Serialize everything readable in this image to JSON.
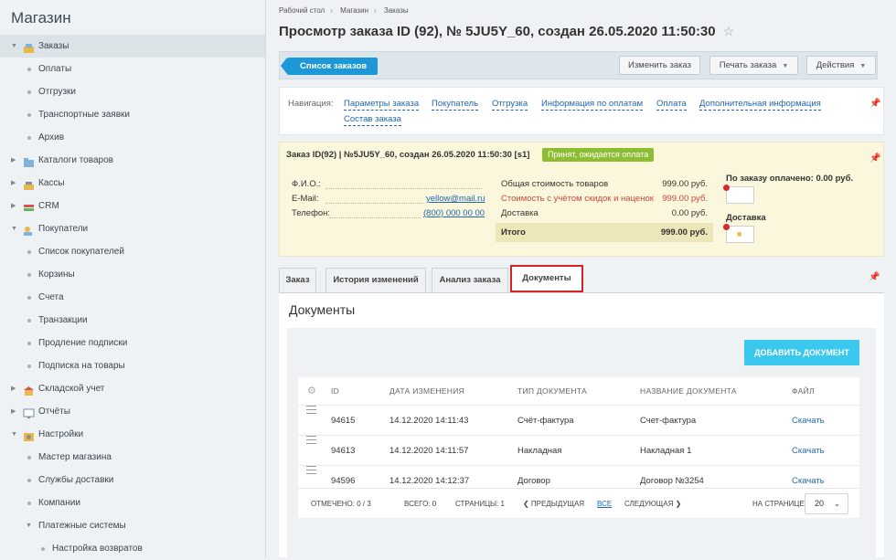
{
  "sidebar": {
    "title": "Магазин",
    "items": [
      {
        "label": "Заказы"
      },
      {
        "label": "Оплаты"
      },
      {
        "label": "Отгрузки"
      },
      {
        "label": "Транспортные заявки"
      },
      {
        "label": "Архив"
      },
      {
        "label": "Каталоги товаров"
      },
      {
        "label": "Кассы"
      },
      {
        "label": "CRM"
      },
      {
        "label": "Покупатели"
      },
      {
        "label": "Список покупателей"
      },
      {
        "label": "Корзины"
      },
      {
        "label": "Счета"
      },
      {
        "label": "Транзакции"
      },
      {
        "label": "Продление подписки"
      },
      {
        "label": "Подписка на товары"
      },
      {
        "label": "Складской учет"
      },
      {
        "label": "Отчёты"
      },
      {
        "label": "Настройки"
      },
      {
        "label": "Мастер магазина"
      },
      {
        "label": "Службы доставки"
      },
      {
        "label": "Компании"
      },
      {
        "label": "Платежные системы"
      },
      {
        "label": "Настройка возвратов"
      }
    ]
  },
  "breadcrumb": [
    "Рабочий стол",
    "Магазин",
    "Заказы"
  ],
  "page_title": "Просмотр заказа ID (92), № 5JU5Y_60, создан 26.05.2020 11:50:30",
  "toolbar": {
    "orders_list": "Список заказов",
    "edit": "Изменить заказ",
    "print": "Печать заказа",
    "actions": "Действия"
  },
  "navigation": {
    "label": "Навигация:",
    "links": [
      "Параметры заказа",
      "Покупатель",
      "Отгрузка",
      "Информация по оплатам",
      "Оплата",
      "Дополнительная информация",
      "Состав заказа"
    ]
  },
  "summary": {
    "header": "Заказ ID(92) | №5JU5Y_60, создан 26.05.2020 11:50:30 [s1]",
    "status": "Принят, ожидается оплата",
    "fio_label": "Ф.И.О.:",
    "email_label": "E-Mail:",
    "email": "yellow@mail.ru",
    "phone_label": "Телефон:",
    "phone": "(800) 000 00 00",
    "goods_label": "Общая стоимость товаров",
    "goods_value": "999.00 руб.",
    "discount_label": "Стоимость с учётом скидок и наценок",
    "discount_value": "999.00 руб.",
    "delivery_label": "Доставка",
    "delivery_value": "0.00 руб.",
    "total_label": "Итого",
    "total_value": "999.00 руб.",
    "paid": "По заказу оплачено: 0.00 руб.",
    "shipping": "Доставка"
  },
  "tabs": [
    "Заказ",
    "История изменений",
    "Анализ заказа",
    "Документы"
  ],
  "documents": {
    "title": "Документы",
    "add_button": "ДОБАВИТЬ ДОКУМЕНТ",
    "columns": [
      "ID",
      "ДАТА ИЗМЕНЕНИЯ",
      "ТИП ДОКУМЕНТА",
      "НАЗВАНИЕ ДОКУМЕНТА",
      "ФАЙЛ"
    ],
    "rows": [
      {
        "id": "94615",
        "date": "14.12.2020 14:11:43",
        "type": "Счёт-фактура",
        "name": "Счет-фактура",
        "file": "Скачать"
      },
      {
        "id": "94613",
        "date": "14.12.2020 14:11:57",
        "type": "Накладная",
        "name": "Накладная 1",
        "file": "Скачать"
      },
      {
        "id": "94596",
        "date": "14.12.2020 14:12:37",
        "type": "Договор",
        "name": "Договор №3254",
        "file": "Скачать"
      }
    ],
    "pager": {
      "selected": "ОТМЕЧЕНО: 0 / 3",
      "total": "ВСЕГО: 0",
      "pages": "СТРАНИЦЫ: 1",
      "prev": "❮ ПРЕДЫДУЩАЯ",
      "all": "ВСЕ",
      "next": "СЛЕДУЮЩАЯ ❯",
      "per_page_label": "НА СТРАНИЦЕ:",
      "per_page": "20"
    }
  }
}
